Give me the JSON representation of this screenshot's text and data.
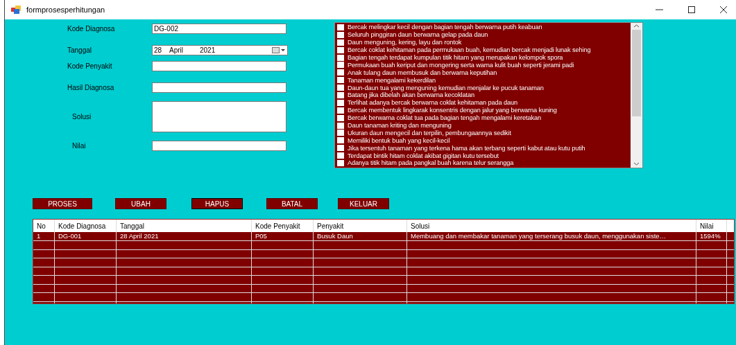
{
  "window": {
    "title": "formprosesperhitungan"
  },
  "form": {
    "fields": [
      {
        "kind": "text",
        "label": "Kode Diagnosa",
        "value": "DG-002"
      },
      {
        "kind": "date",
        "label": "Tanggal",
        "day": "28",
        "month": "April",
        "year": "2021"
      },
      {
        "kind": "text",
        "label": "Kode Penyakit"
      },
      {
        "kind": "text",
        "label": "Hasil Diagnosa"
      },
      {
        "kind": "textarea",
        "label": "Solusi"
      },
      {
        "kind": "text",
        "label": "Nilai"
      }
    ]
  },
  "symptoms": [
    {
      "label": "Bercak melingkar kecil dengan bagian tengah berwarna putih keabuan",
      "checked": false
    },
    {
      "label": "Seluruh pinggiran daun berwarna gelap pada daun",
      "checked": false
    },
    {
      "label": "Daun menguning, kering, layu dan rontok",
      "checked": false
    },
    {
      "label": "Bercak coklat kehitaman pada permukaan buah, kemudian bercak menjadi lunak sehing",
      "checked": false
    },
    {
      "label": "Bagian tengah terdapat kumpulan titik hitam yang merupakan kelompok spora",
      "checked": false
    },
    {
      "label": "Permukaan buah keriput dan mongering serta warna kulit buah seperti jerami padi",
      "checked": false
    },
    {
      "label": "Anak tulang daun membusuk dan berwarna keputihan",
      "checked": false
    },
    {
      "label": "Tanaman mengalami kekerdilan",
      "checked": false
    },
    {
      "label": "Daun-daun tua yang menguning kemudian menjalar ke pucuk tanaman",
      "checked": false
    },
    {
      "label": "Batang jika dibelah akan berwarna kecoklatan",
      "checked": false
    },
    {
      "label": "Terlihat adanya bercak berwarna coklat kehitaman pada daun",
      "checked": false
    },
    {
      "label": "Bercak membentuk lingkarak konsentris dengan jalur yang berwarna kuning",
      "checked": false
    },
    {
      "label": "Bercak berwarna coklat tua pada bagian tengah mengalami keretakan",
      "checked": false
    },
    {
      "label": "Daun tanaman kriting dan menguning",
      "checked": false
    },
    {
      "label": "Ukuran daun mengecil dan terpilin, pembungaannya sedikit",
      "checked": false
    },
    {
      "label": "Memiliki bentuk buah yang kecil-kecil",
      "checked": false
    },
    {
      "label": "Jika tersentuh tanaman yang terkena hama akan terbang seperti kabut atau kutu putih",
      "checked": false
    },
    {
      "label": "Terdapat bintik hitam coklat akibat gigitan kutu tersebut",
      "checked": false
    },
    {
      "label": "Adanya titik hitam pada pangkal buah karena telur serangga",
      "checked": false
    }
  ],
  "buttons": [
    "PROSES",
    "UBAH",
    "HAPUS",
    "BATAL",
    "KELUAR"
  ],
  "table": {
    "columns": [
      "No",
      "Kode Diagnosa",
      "Tanggal",
      "Kode Penyakit",
      "Penyakit",
      "Solusi",
      "Nilai"
    ],
    "rows": [
      [
        "1",
        "DG-001",
        "28 April 2021",
        "P05",
        "Busuk Daun",
        "Membuang dan membakar tanaman yang terserang busuk daun, menggunakan siste…",
        "1594%"
      ]
    ]
  }
}
